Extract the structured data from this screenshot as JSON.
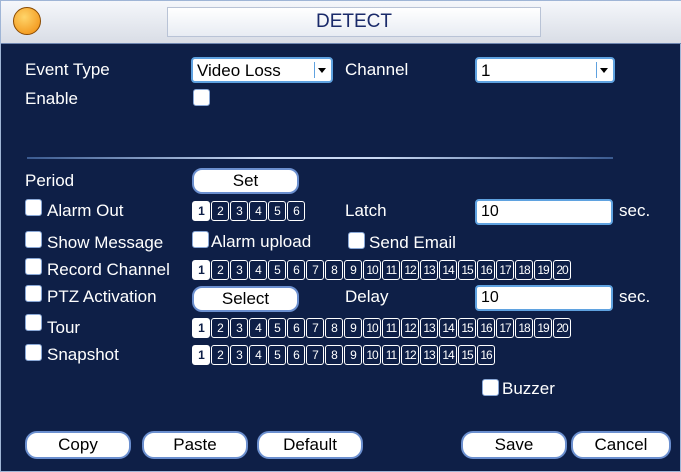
{
  "title": "DETECT",
  "colors": {
    "background": "#0e1f47",
    "accent": "#5fa2e0",
    "title_bg": "#e8ecf3"
  },
  "event_type": {
    "label": "Event Type",
    "value": "Video Loss"
  },
  "channel": {
    "label": "Channel",
    "value": "1"
  },
  "enable": {
    "label": "Enable",
    "checked": false
  },
  "period": {
    "label": "Period",
    "button": "Set"
  },
  "alarm_out": {
    "label": "Alarm Out",
    "checked": false,
    "channels": [
      "1",
      "2",
      "3",
      "4",
      "5",
      "6"
    ],
    "selected": [
      "1"
    ]
  },
  "latch": {
    "label": "Latch",
    "value": "10",
    "unit": "sec."
  },
  "show_message": {
    "label": "Show Message",
    "checked": false
  },
  "alarm_upload": {
    "label": "Alarm upload",
    "checked": false
  },
  "send_email": {
    "label": "Send Email",
    "checked": false
  },
  "record_channel": {
    "label": "Record Channel",
    "checked": false,
    "channels": [
      "1",
      "2",
      "3",
      "4",
      "5",
      "6",
      "7",
      "8",
      "9",
      "10",
      "11",
      "12",
      "13",
      "14",
      "15",
      "16",
      "17",
      "18",
      "19",
      "20"
    ],
    "selected": [
      "1"
    ]
  },
  "ptz": {
    "label": "PTZ Activation",
    "checked": false,
    "button": "Select"
  },
  "delay": {
    "label": "Delay",
    "value": "10",
    "unit": "sec."
  },
  "tour": {
    "label": "Tour",
    "checked": false,
    "channels": [
      "1",
      "2",
      "3",
      "4",
      "5",
      "6",
      "7",
      "8",
      "9",
      "10",
      "11",
      "12",
      "13",
      "14",
      "15",
      "16",
      "17",
      "18",
      "19",
      "20"
    ],
    "selected": [
      "1"
    ]
  },
  "snapshot": {
    "label": "Snapshot",
    "checked": false,
    "channels": [
      "1",
      "2",
      "3",
      "4",
      "5",
      "6",
      "7",
      "8",
      "9",
      "10",
      "11",
      "12",
      "13",
      "14",
      "15",
      "16"
    ],
    "selected": [
      "1"
    ]
  },
  "buzzer": {
    "label": "Buzzer",
    "checked": false
  },
  "buttons": {
    "copy": "Copy",
    "paste": "Paste",
    "default": "Default",
    "save": "Save",
    "cancel": "Cancel"
  }
}
